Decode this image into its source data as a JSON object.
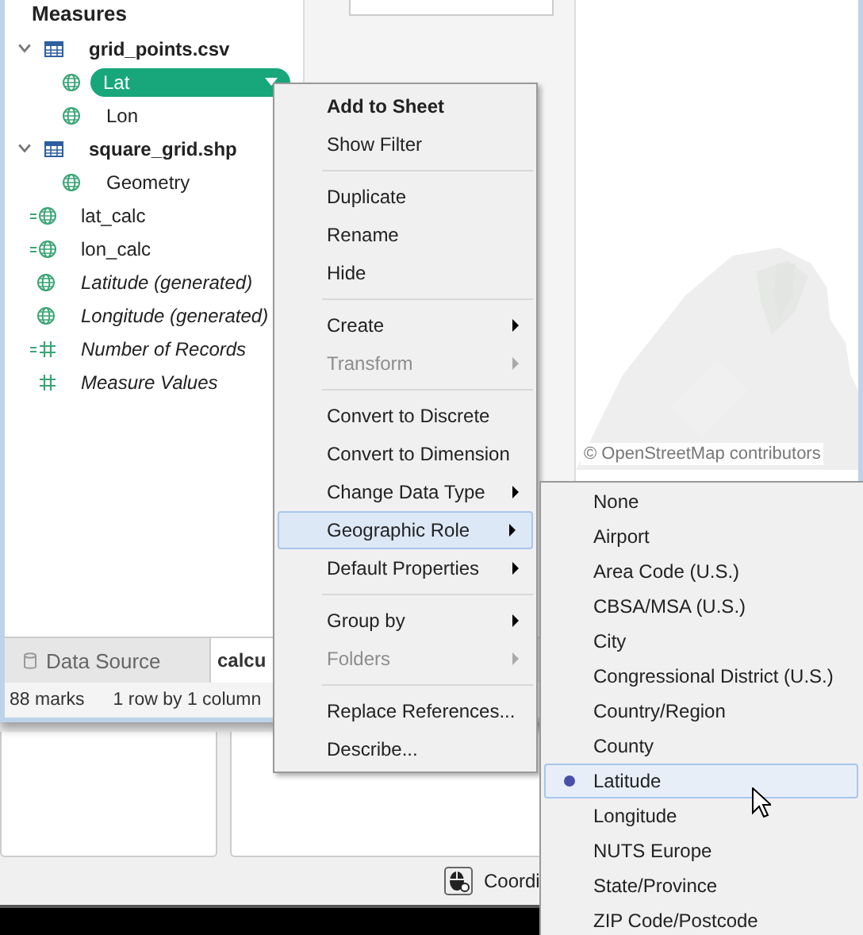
{
  "data_pane": {
    "title": "Measures",
    "items": [
      {
        "kind": "table",
        "label": "grid_points.csv",
        "italic": false,
        "expanded": true,
        "children": [
          {
            "kind": "geo",
            "label": "Lat",
            "italic": false,
            "selected": true
          },
          {
            "kind": "geo",
            "label": "Lon",
            "italic": false,
            "selected": false
          }
        ]
      },
      {
        "kind": "table",
        "label": "square_grid.shp",
        "italic": false,
        "expanded": true,
        "children": [
          {
            "kind": "geo",
            "label": "Geometry",
            "italic": false,
            "selected": false
          }
        ]
      },
      {
        "kind": "calc_geo",
        "label": "lat_calc",
        "italic": false
      },
      {
        "kind": "calc_geo",
        "label": "lon_calc",
        "italic": false
      },
      {
        "kind": "geo",
        "label": "Latitude (generated)",
        "italic": true
      },
      {
        "kind": "geo",
        "label": "Longitude (generated)",
        "italic": true
      },
      {
        "kind": "calc_measure",
        "label": "Number of Records",
        "italic": true
      },
      {
        "kind": "measure",
        "label": "Measure Values",
        "italic": true
      }
    ]
  },
  "map": {
    "attribution": "© OpenStreetMap contributors"
  },
  "tabs": [
    {
      "kind": "data_source",
      "label": "Data Source",
      "selected": false
    },
    {
      "kind": "sheet",
      "label": "calcu",
      "selected": true
    }
  ],
  "status_bar": [
    "88 marks",
    "1 row by 1 column"
  ],
  "context_menu": {
    "groups": [
      [
        {
          "label": "Add to Sheet",
          "bold": true,
          "disabled": false,
          "submenu": false,
          "selected": false
        },
        {
          "label": "Show Filter",
          "bold": false,
          "disabled": false,
          "submenu": false,
          "selected": false
        }
      ],
      [
        {
          "label": "Duplicate",
          "bold": false,
          "disabled": false,
          "submenu": false,
          "selected": false
        },
        {
          "label": "Rename",
          "bold": false,
          "disabled": false,
          "submenu": false,
          "selected": false
        },
        {
          "label": "Hide",
          "bold": false,
          "disabled": false,
          "submenu": false,
          "selected": false
        }
      ],
      [
        {
          "label": "Create",
          "bold": false,
          "disabled": false,
          "submenu": true,
          "selected": false
        },
        {
          "label": "Transform",
          "bold": false,
          "disabled": true,
          "submenu": true,
          "selected": false
        }
      ],
      [
        {
          "label": "Convert to Discrete",
          "bold": false,
          "disabled": false,
          "submenu": false,
          "selected": false
        },
        {
          "label": "Convert to Dimension",
          "bold": false,
          "disabled": false,
          "submenu": false,
          "selected": false
        },
        {
          "label": "Change Data Type",
          "bold": false,
          "disabled": false,
          "submenu": true,
          "selected": false
        },
        {
          "label": "Geographic Role",
          "bold": false,
          "disabled": false,
          "submenu": true,
          "selected": true
        },
        {
          "label": "Default Properties",
          "bold": false,
          "disabled": false,
          "submenu": true,
          "selected": false
        }
      ],
      [
        {
          "label": "Group by",
          "bold": false,
          "disabled": false,
          "submenu": true,
          "selected": false
        },
        {
          "label": "Folders",
          "bold": false,
          "disabled": true,
          "submenu": true,
          "selected": false
        }
      ],
      [
        {
          "label": "Replace References...",
          "bold": false,
          "disabled": false,
          "submenu": false,
          "selected": false
        },
        {
          "label": "Describe...",
          "bold": false,
          "disabled": false,
          "submenu": false,
          "selected": false
        }
      ]
    ]
  },
  "geographic_role_menu": [
    {
      "label": "None",
      "selected": false
    },
    {
      "label": "Airport",
      "selected": false
    },
    {
      "label": "Area Code (U.S.)",
      "selected": false
    },
    {
      "label": "CBSA/MSA (U.S.)",
      "selected": false
    },
    {
      "label": "City",
      "selected": false
    },
    {
      "label": "Congressional District (U.S.)",
      "selected": false
    },
    {
      "label": "Country/Region",
      "selected": false
    },
    {
      "label": "County",
      "selected": false
    },
    {
      "label": "Latitude",
      "selected": true
    },
    {
      "label": "Longitude",
      "selected": false
    },
    {
      "label": "NUTS Europe",
      "selected": false
    },
    {
      "label": "State/Province",
      "selected": false
    },
    {
      "label": "ZIP Code/Postcode",
      "selected": false
    }
  ],
  "background_window": {
    "status_text": "Coordi"
  }
}
